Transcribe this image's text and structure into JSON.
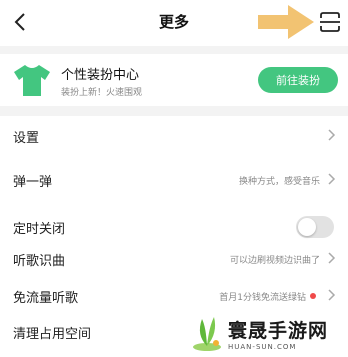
{
  "header": {
    "title": "更多"
  },
  "theme_card": {
    "title": "个性装扮中心",
    "subtitle": "装扮上新！火速围观",
    "button_label": "前往装扮"
  },
  "settings": {
    "label": "设置"
  },
  "popup": {
    "label": "弹一弹",
    "desc": "换种方式，感受音乐"
  },
  "timer": {
    "label": "定时关闭",
    "enabled": false
  },
  "song_recognition": {
    "label": "听歌识曲",
    "desc": "可以边刷视频边识曲了"
  },
  "free_data": {
    "label": "免流量听歌",
    "desc": "首月1分钱免流送绿钻"
  },
  "storage": {
    "label": "清理占用空间"
  },
  "watermark": {
    "name": "寰晟手游网",
    "url": "HUAN-SUN.COM"
  },
  "colors": {
    "accent": "#43c680",
    "arrow": "#f2c372",
    "badge": "#f04a4a"
  }
}
